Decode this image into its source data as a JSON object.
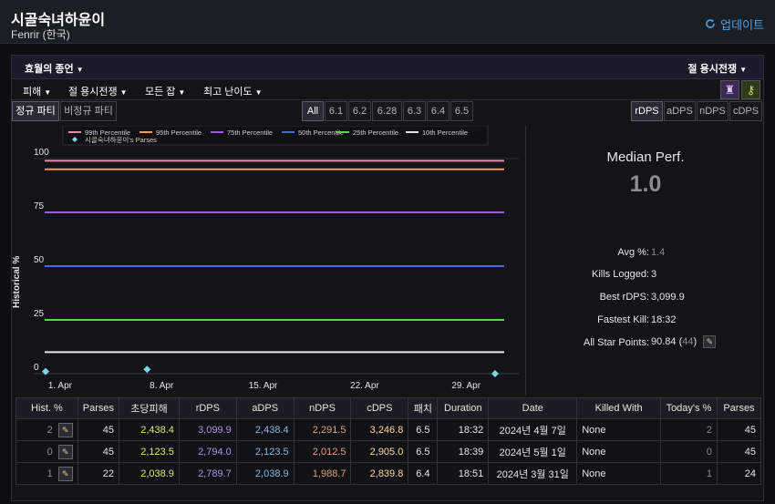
{
  "header": {
    "character_name": "시골숙녀하윤이",
    "server": "Fenrir (한국)",
    "update_label": "업데이트",
    "update_icon": "refresh-icon"
  },
  "filters": {
    "encounter": "효월의 종언",
    "partition": "절 용시전쟁",
    "metric_filter": "피해",
    "zone_filter": "절 용시전쟁",
    "spec_filter": "모든 잡",
    "difficulty_filter": "최고 난이도",
    "party_types": [
      "정규 파티",
      "비정규 파티"
    ],
    "patches": [
      "All",
      "6.1",
      "6.2",
      "6.28",
      "6.3",
      "6.4",
      "6.5"
    ],
    "dps_types": [
      "rDPS",
      "aDPS",
      "nDPS",
      "cDPS"
    ]
  },
  "chart_data": {
    "type": "line",
    "ylabel": "Historical %",
    "ylim": [
      0,
      100
    ],
    "y_ticks": [
      "0",
      "25",
      "50",
      "75",
      "100"
    ],
    "x_ticks": [
      "1. Apr",
      "8. Apr",
      "15. Apr",
      "22. Apr",
      "29. Apr"
    ],
    "series": [
      {
        "name": "99th Percentile",
        "color": "#e88ab0",
        "value": 99
      },
      {
        "name": "95th Percentile",
        "color": "#ff9a4d",
        "value": 95
      },
      {
        "name": "75th Percentile",
        "color": "#9a5cf0",
        "value": 75
      },
      {
        "name": "50th Percentile",
        "color": "#4a66e8",
        "value": 50
      },
      {
        "name": "25th Percentile",
        "color": "#58d84a",
        "value": 25
      },
      {
        "name": "10th Percentile",
        "color": "#e6e6e6",
        "value": 10
      }
    ],
    "parses_series": {
      "name": "시골숙녀하윤이's Parses",
      "color": "#7fd4e8",
      "points": [
        {
          "x": "2024-03-31",
          "y": 1
        },
        {
          "x": "2024-04-07",
          "y": 2
        },
        {
          "x": "2024-05-01",
          "y": 0
        }
      ]
    },
    "x_range": [
      "2024-03-31",
      "2024-05-01"
    ],
    "legend_position": "top"
  },
  "stats": {
    "median_title": "Median Perf.",
    "median_value": "1.0",
    "rows": [
      {
        "label": "Avg %:",
        "value": "1.4",
        "dim": true
      },
      {
        "label": "Kills Logged:",
        "value": "3"
      },
      {
        "label": "Best rDPS:",
        "value": "3,099.9"
      },
      {
        "label": "Fastest Kill:",
        "value": "18:32"
      },
      {
        "label": "All Star Points:",
        "value": "90.84",
        "extra": "44"
      }
    ]
  },
  "table": {
    "headers": [
      "Hist. %",
      "Parses",
      "초당피해",
      "rDPS",
      "aDPS",
      "nDPS",
      "cDPS",
      "패치",
      "Duration",
      "Date",
      "Killed With",
      "Today's %",
      "Parses"
    ],
    "rows": [
      {
        "hist": "2",
        "parses": "45",
        "dmg": "2,438.4",
        "rdps": "3,099.9",
        "adps": "2,438.4",
        "ndps": "2,291.5",
        "cdps": "3,246.8",
        "patch": "6.5",
        "duration": "18:32",
        "date": "2024년 4월 7일",
        "killed_with": "None",
        "today": "2",
        "parses2": "45"
      },
      {
        "hist": "0",
        "parses": "45",
        "dmg": "2,123.5",
        "rdps": "2,794.0",
        "adps": "2,123.5",
        "ndps": "2,012.5",
        "cdps": "2,905.0",
        "patch": "6.5",
        "duration": "18:39",
        "date": "2024년 5월 1일",
        "killed_with": "None",
        "today": "0",
        "parses2": "45"
      },
      {
        "hist": "1",
        "parses": "22",
        "dmg": "2,038.9",
        "rdps": "2,789.7",
        "adps": "2,038.9",
        "ndps": "1,988.7",
        "cdps": "2,839.8",
        "patch": "6.4",
        "duration": "18:51",
        "date": "2024년 3월 31일",
        "killed_with": "None",
        "today": "1",
        "parses2": "24"
      }
    ]
  }
}
